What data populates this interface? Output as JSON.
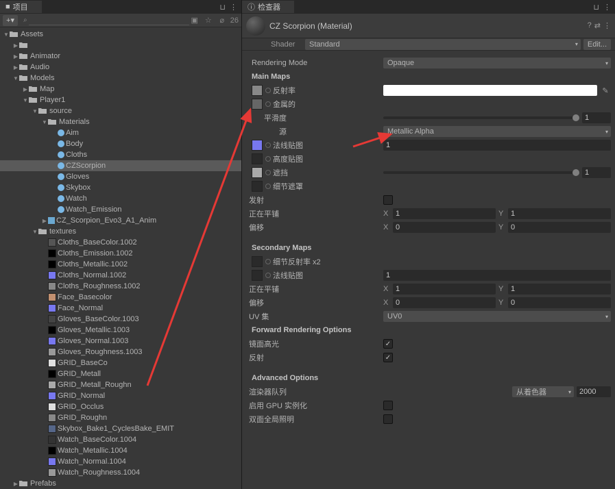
{
  "leftPanel": {
    "tabLabel": "项目",
    "visibilityCount": "26",
    "tree": {
      "root": "Assets",
      "items": [
        {
          "d": 1,
          "type": "folder",
          "label": "",
          "open": false
        },
        {
          "d": 1,
          "type": "folder",
          "label": "Animator",
          "open": false
        },
        {
          "d": 1,
          "type": "folder",
          "label": "Audio",
          "open": false
        },
        {
          "d": 1,
          "type": "folder",
          "label": "Models",
          "open": true
        },
        {
          "d": 2,
          "type": "folder",
          "label": "Map",
          "open": false
        },
        {
          "d": 2,
          "type": "folder",
          "label": "Player1",
          "open": true
        },
        {
          "d": 3,
          "type": "folder",
          "label": "source",
          "open": true
        },
        {
          "d": 4,
          "type": "folder",
          "label": "Materials",
          "open": true
        },
        {
          "d": 5,
          "type": "mat",
          "label": "Aim"
        },
        {
          "d": 5,
          "type": "mat",
          "label": "Body"
        },
        {
          "d": 5,
          "type": "mat",
          "label": "Cloths"
        },
        {
          "d": 5,
          "type": "mat",
          "label": "CZScorpion",
          "selected": true
        },
        {
          "d": 5,
          "type": "mat",
          "label": "Gloves"
        },
        {
          "d": 5,
          "type": "mat",
          "label": "Skybox"
        },
        {
          "d": 5,
          "type": "mat",
          "label": "Watch"
        },
        {
          "d": 5,
          "type": "mat",
          "label": "Watch_Emission"
        },
        {
          "d": 4,
          "type": "prefab",
          "label": "CZ_Scorpion_Evo3_A1_Anim"
        },
        {
          "d": 3,
          "type": "folder",
          "label": "textures",
          "open": true
        },
        {
          "d": 4,
          "type": "tex",
          "label": "Cloths_BaseColor.1002",
          "color": "#555"
        },
        {
          "d": 4,
          "type": "tex",
          "label": "Cloths_Emission.1002",
          "color": "#000"
        },
        {
          "d": 4,
          "type": "tex",
          "label": "Cloths_Metallic.1002",
          "color": "#000"
        },
        {
          "d": 4,
          "type": "tex",
          "label": "Cloths_Normal.1002",
          "color": "#7878f0"
        },
        {
          "d": 4,
          "type": "tex",
          "label": "Cloths_Roughness.1002",
          "color": "#888"
        },
        {
          "d": 4,
          "type": "tex",
          "label": "Face_Basecolor",
          "color": "#c29070"
        },
        {
          "d": 4,
          "type": "tex",
          "label": "Face_Normal",
          "color": "#7878f0"
        },
        {
          "d": 4,
          "type": "tex",
          "label": "Gloves_BaseColor.1003",
          "color": "#444"
        },
        {
          "d": 4,
          "type": "tex",
          "label": "Gloves_Metallic.1003",
          "color": "#000"
        },
        {
          "d": 4,
          "type": "tex",
          "label": "Gloves_Normal.1003",
          "color": "#7878f0"
        },
        {
          "d": 4,
          "type": "tex",
          "label": "Gloves_Roughness.1003",
          "color": "#999"
        },
        {
          "d": 4,
          "type": "tex",
          "label": "GRID_BaseCo",
          "color": "#e0e0e0"
        },
        {
          "d": 4,
          "type": "tex",
          "label": "GRID_Metall",
          "color": "#000"
        },
        {
          "d": 4,
          "type": "tex",
          "label": "GRID_Metall_Roughn",
          "color": "#aaa"
        },
        {
          "d": 4,
          "type": "tex",
          "label": "GRID_Normal",
          "color": "#7878f0"
        },
        {
          "d": 4,
          "type": "tex",
          "label": "GRID_Occlus",
          "color": "#ddd"
        },
        {
          "d": 4,
          "type": "tex",
          "label": "GRID_Roughn",
          "color": "#888"
        },
        {
          "d": 4,
          "type": "tex",
          "label": "Skybox_Bake1_CyclesBake_EMIT",
          "color": "#556688"
        },
        {
          "d": 4,
          "type": "tex",
          "label": "Watch_BaseColor.1004",
          "color": "#333"
        },
        {
          "d": 4,
          "type": "tex",
          "label": "Watch_Metallic.1004",
          "color": "#000"
        },
        {
          "d": 4,
          "type": "tex",
          "label": "Watch_Normal.1004",
          "color": "#7878f0"
        },
        {
          "d": 4,
          "type": "tex",
          "label": "Watch_Roughness.1004",
          "color": "#999"
        },
        {
          "d": 1,
          "type": "folder",
          "label": "Prefabs",
          "open": false
        }
      ]
    }
  },
  "rightPanel": {
    "tabLabel": "检查器",
    "materialName": "CZ Scorpion (Material)",
    "shaderLabel": "Shader",
    "shaderValue": "Standard",
    "editBtn": "Edit...",
    "renderingModeLabel": "Rendering Mode",
    "renderingModeValue": "Opaque",
    "mainMapsLabel": "Main Maps",
    "albedoLabel": "反射率",
    "metallicLabel": "金属的",
    "smoothnessLabel": "平滑度",
    "smoothnessValue": "1",
    "sourceLabel": "源",
    "sourceValue": "Metallic Alpha",
    "normalMapLabel": "法线贴图",
    "normalMapValue": "1",
    "heightMapLabel": "高度贴图",
    "occlusionLabel": "遮挡",
    "occlusionValue": "1",
    "detailMaskLabel": "细节遮罩",
    "emissionLabel": "发射",
    "tilingLabel": "正在平铺",
    "tilingX": "1",
    "tilingY": "1",
    "offsetLabel": "偏移",
    "offsetX": "0",
    "offsetY": "0",
    "secondaryMapsLabel": "Secondary Maps",
    "detailAlbedoLabel": "细节反射率 x2",
    "detailNormalLabel": "法线贴图",
    "detailNormalValue": "1",
    "secTilingX": "1",
    "secTilingY": "1",
    "secOffsetX": "0",
    "secOffsetY": "0",
    "uvSetLabel": "UV 集",
    "uvSetValue": "UV0",
    "forwardOptionsLabel": "Forward Rendering Options",
    "specHighlightsLabel": "镜面高光",
    "reflectionsLabel": "反射",
    "advancedOptionsLabel": "Advanced Options",
    "renderQueueLabel": "渲染器队列",
    "renderQueueMode": "从着色器",
    "renderQueueValue": "2000",
    "gpuInstancingLabel": "启用 GPU 实例化",
    "doubleSidedLabel": "双面全局照明"
  }
}
